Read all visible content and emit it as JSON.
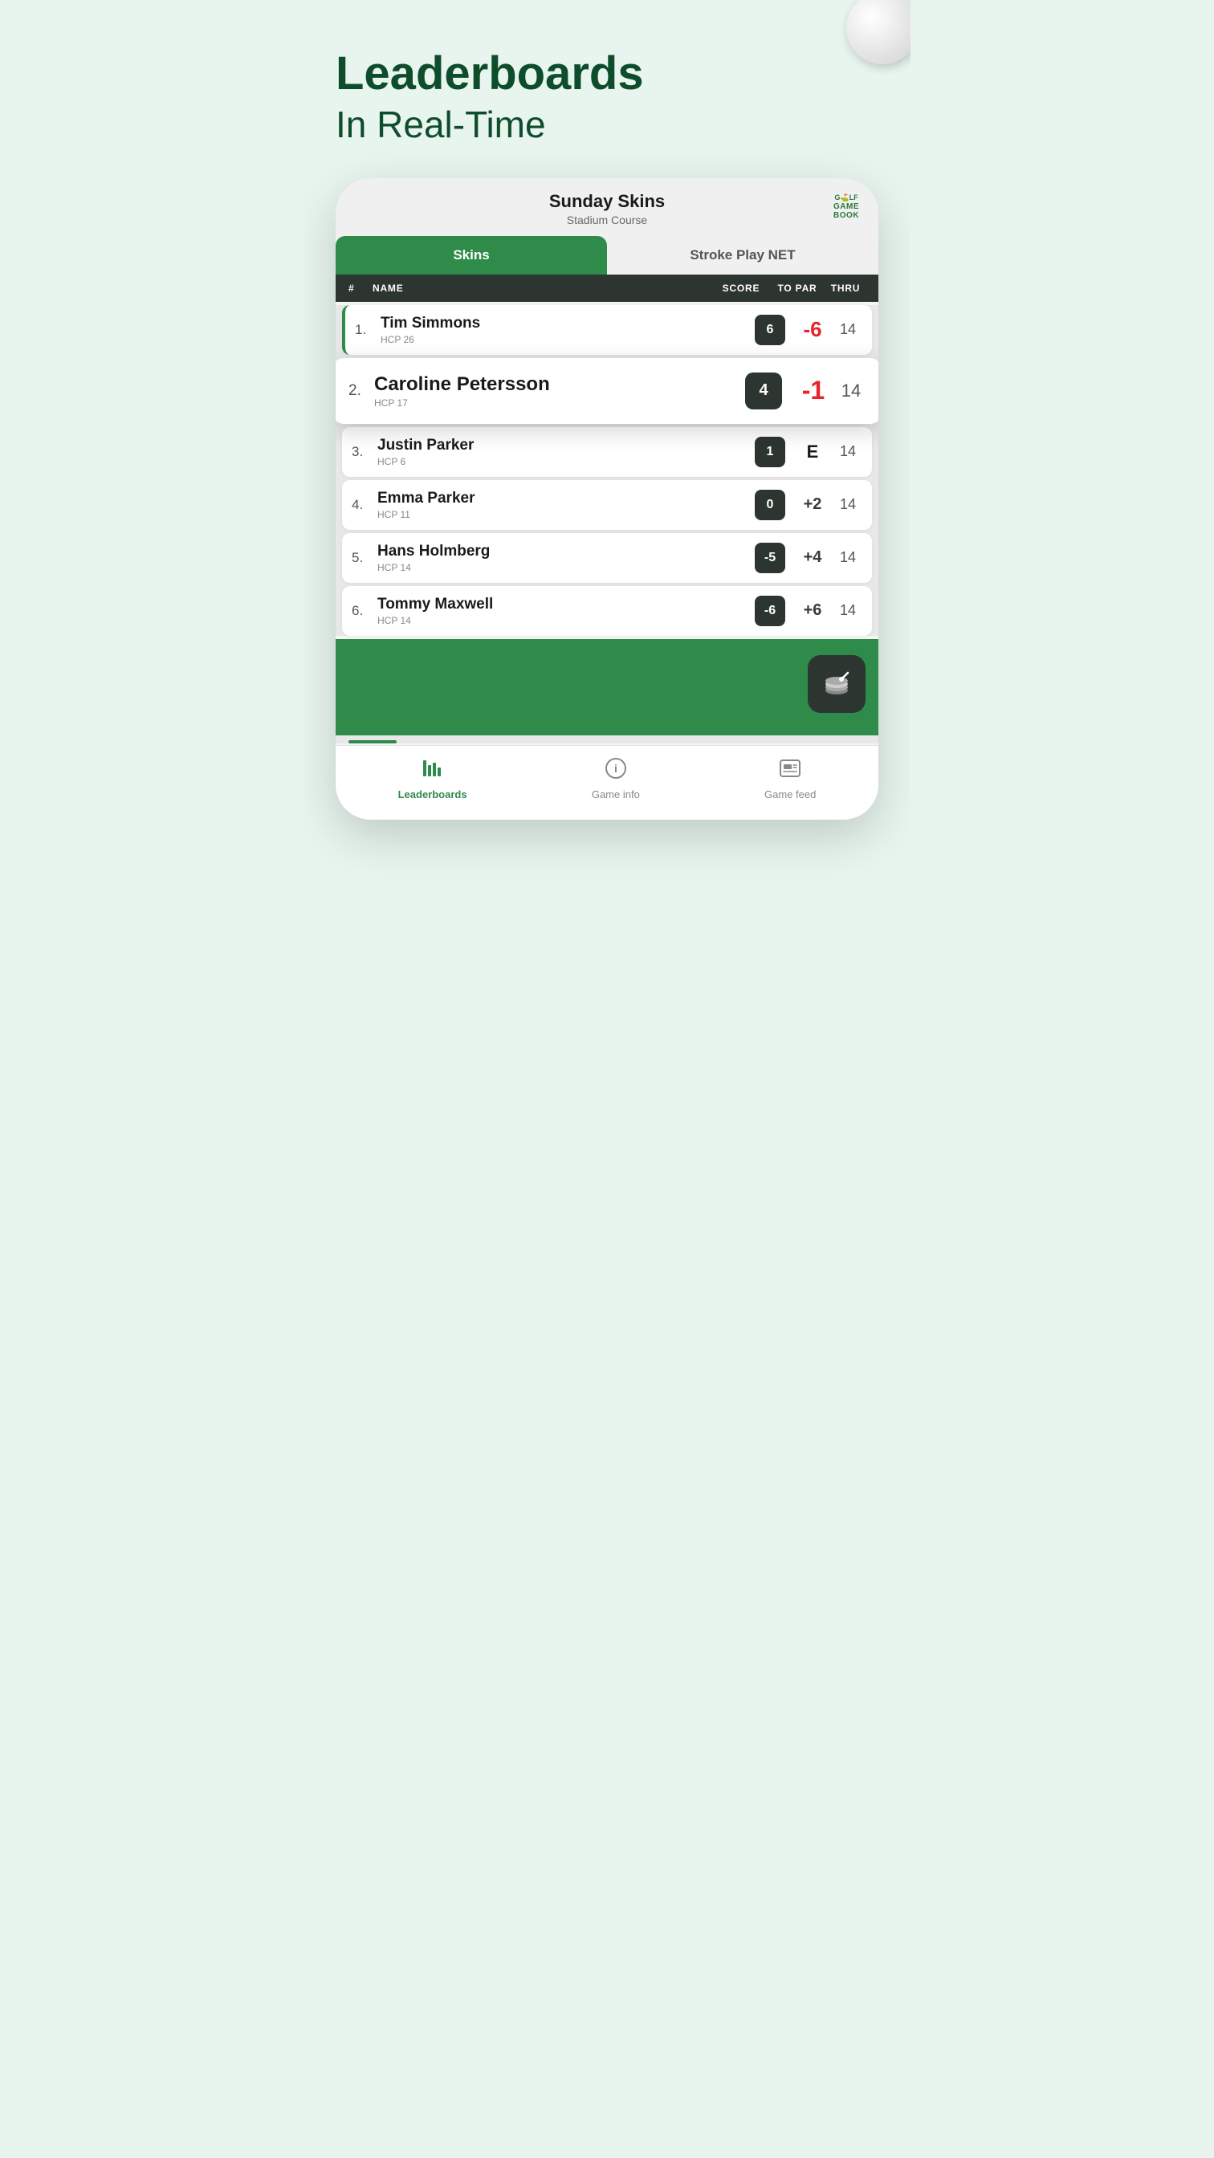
{
  "page": {
    "background_color": "#e8f5ee",
    "headline": "Leaderboards",
    "subheadline": "In Real-Time"
  },
  "golf_ball": {
    "visible": true
  },
  "app": {
    "title": "Sunday Skins",
    "subtitle": "Stadium Course",
    "logo_line1": "G⛳LF",
    "logo_line2": "GAME",
    "logo_line3": "BOOK"
  },
  "tabs": [
    {
      "label": "Skins",
      "active": true
    },
    {
      "label": "Stroke Play NET",
      "active": false
    }
  ],
  "table_headers": {
    "rank": "#",
    "name": "NAME",
    "score": "SCORE",
    "topar": "TO PAR",
    "thru": "THRU"
  },
  "players": [
    {
      "rank": "1.",
      "name": "Tim Simmons",
      "hcp": "HCP 26",
      "score": "6",
      "topar": "-6",
      "topar_color": "red",
      "thru": "14",
      "highlighted": false,
      "first": true
    },
    {
      "rank": "2.",
      "name": "Caroline Petersson",
      "hcp": "HCP 17",
      "score": "4",
      "topar": "-1",
      "topar_color": "red",
      "thru": "14",
      "highlighted": true,
      "first": false
    },
    {
      "rank": "3.",
      "name": "Justin Parker",
      "hcp": "HCP 6",
      "score": "1",
      "topar": "E",
      "topar_color": "dark",
      "thru": "14",
      "highlighted": false,
      "first": false
    },
    {
      "rank": "4.",
      "name": "Emma Parker",
      "hcp": "HCP 11",
      "score": "0",
      "topar": "+2",
      "topar_color": "dark",
      "thru": "14",
      "highlighted": false,
      "first": false
    },
    {
      "rank": "5.",
      "name": "Hans Holmberg",
      "hcp": "HCP 14",
      "score": "-5",
      "topar": "+4",
      "topar_color": "dark",
      "thru": "14",
      "highlighted": false,
      "first": false
    },
    {
      "rank": "6.",
      "name": "Tommy Maxwell",
      "hcp": "HCP 14",
      "score": "-6",
      "topar": "+6",
      "topar_color": "dark",
      "thru": "14",
      "highlighted": false,
      "first": false
    }
  ],
  "bottom_nav": [
    {
      "label": "Leaderboards",
      "icon": "☰",
      "active": true
    },
    {
      "label": "Game info",
      "icon": "ℹ",
      "active": false
    },
    {
      "label": "Game feed",
      "icon": "🖼",
      "active": false
    }
  ]
}
